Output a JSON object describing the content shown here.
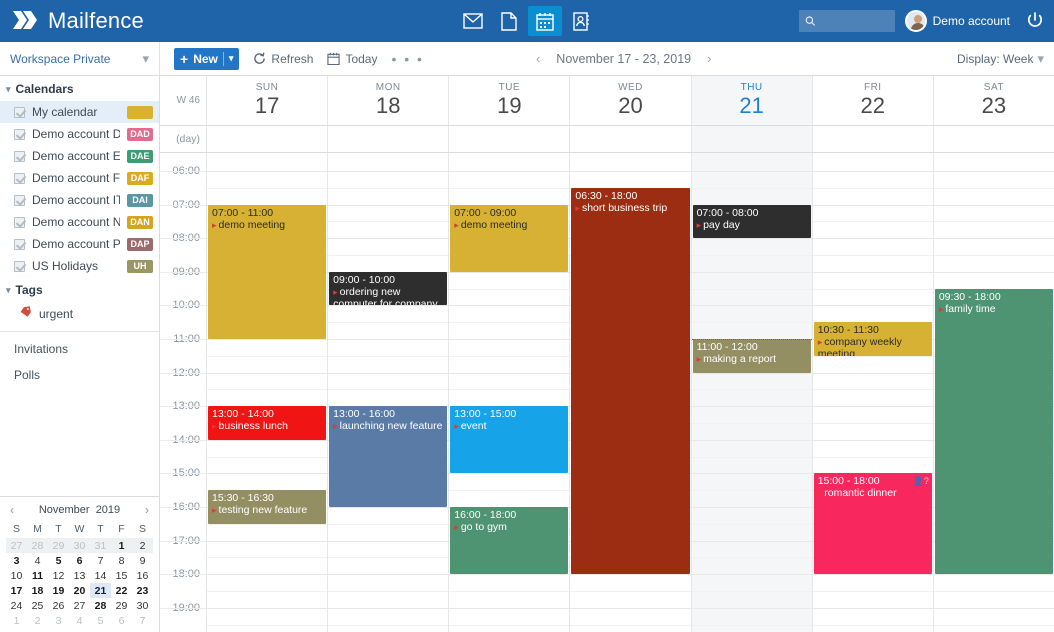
{
  "app": {
    "brand": "Mailfence",
    "nav_icons": [
      "mail-icon",
      "documents-icon",
      "calendar-icon",
      "contacts-icon"
    ],
    "active_nav": "calendar-icon",
    "search_placeholder": "",
    "search_value": "",
    "account_name": "Demo account",
    "power_icon": "power-icon"
  },
  "toolbar": {
    "workspace_label": "Workspace Private",
    "new_label": "New",
    "refresh_label": "Refresh",
    "today_label": "Today",
    "more_label": "• • •",
    "date_range": "November 17 - 23, 2019",
    "prev_label": "‹",
    "next_label": "›",
    "display_label": "Display: Week"
  },
  "sidebar": {
    "calendars_header": "Calendars",
    "calendars": [
      {
        "label": "My calendar",
        "badge": "",
        "color": "#dcb12e",
        "selected": true,
        "swatch": true
      },
      {
        "label": "Demo account DE",
        "badge": "DAD",
        "color": "#e06c8f",
        "selected": false,
        "swatch": false
      },
      {
        "label": "Demo account ES",
        "badge": "DAE",
        "color": "#3f9c74",
        "selected": false,
        "swatch": false
      },
      {
        "label": "Demo account FR",
        "badge": "DAF",
        "color": "#d9ab1e",
        "selected": false,
        "swatch": false
      },
      {
        "label": "Demo account IT",
        "badge": "DAI",
        "color": "#5a97a3",
        "selected": false,
        "swatch": false
      },
      {
        "label": "Demo account NL",
        "badge": "DAN",
        "color": "#d6a51c",
        "selected": false,
        "swatch": false
      },
      {
        "label": "Demo account PT",
        "badge": "DAP",
        "color": "#9c6a6a",
        "selected": false,
        "swatch": false
      },
      {
        "label": "US Holidays",
        "badge": "UH",
        "color": "#9a9764",
        "selected": false,
        "swatch": false
      }
    ],
    "tags_header": "Tags",
    "tags": [
      {
        "label": "urgent",
        "icon": "tag-icon",
        "color": "#d14b3c"
      }
    ],
    "links": [
      "Invitations",
      "Polls"
    ]
  },
  "minical": {
    "month": "November",
    "year": "2019",
    "prev": "‹",
    "next": "›",
    "dow": [
      "S",
      "M",
      "T",
      "W",
      "T",
      "F",
      "S"
    ],
    "weeks": [
      {
        "shade": true,
        "days": [
          {
            "n": "27",
            "out": true
          },
          {
            "n": "28",
            "out": true
          },
          {
            "n": "29",
            "out": true
          },
          {
            "n": "30",
            "out": true
          },
          {
            "n": "31",
            "out": true
          },
          {
            "n": "1",
            "bold": true
          },
          {
            "n": "2"
          }
        ]
      },
      {
        "shade": false,
        "days": [
          {
            "n": "3",
            "bold": true
          },
          {
            "n": "4"
          },
          {
            "n": "5",
            "bold": true
          },
          {
            "n": "6",
            "bold": true
          },
          {
            "n": "7"
          },
          {
            "n": "8"
          },
          {
            "n": "9"
          }
        ]
      },
      {
        "shade": false,
        "days": [
          {
            "n": "10"
          },
          {
            "n": "11",
            "bold": true
          },
          {
            "n": "12"
          },
          {
            "n": "13"
          },
          {
            "n": "14"
          },
          {
            "n": "15"
          },
          {
            "n": "16"
          }
        ]
      },
      {
        "shade": false,
        "days": [
          {
            "n": "17",
            "bold": true
          },
          {
            "n": "18",
            "bold": true
          },
          {
            "n": "19",
            "bold": true
          },
          {
            "n": "20",
            "bold": true
          },
          {
            "n": "21",
            "today": true
          },
          {
            "n": "22",
            "bold": true
          },
          {
            "n": "23",
            "bold": true
          }
        ]
      },
      {
        "shade": false,
        "days": [
          {
            "n": "24"
          },
          {
            "n": "25"
          },
          {
            "n": "26"
          },
          {
            "n": "27"
          },
          {
            "n": "28",
            "bold": true
          },
          {
            "n": "29"
          },
          {
            "n": "30"
          }
        ]
      },
      {
        "shade": false,
        "days": [
          {
            "n": "1",
            "out": true
          },
          {
            "n": "2",
            "out": true
          },
          {
            "n": "3",
            "out": true
          },
          {
            "n": "4",
            "out": true
          },
          {
            "n": "5",
            "out": true
          },
          {
            "n": "6",
            "out": true
          },
          {
            "n": "7",
            "out": true
          }
        ]
      }
    ]
  },
  "calendar": {
    "week_label": "W 46",
    "allday_label": "(day)",
    "days": [
      {
        "dow": "SUN",
        "num": "17",
        "today": false
      },
      {
        "dow": "MON",
        "num": "18",
        "today": false
      },
      {
        "dow": "TUE",
        "num": "19",
        "today": false
      },
      {
        "dow": "WED",
        "num": "20",
        "today": false
      },
      {
        "dow": "THU",
        "num": "21",
        "today": true
      },
      {
        "dow": "FRI",
        "num": "22",
        "today": false
      },
      {
        "dow": "SAT",
        "num": "23",
        "today": false
      }
    ],
    "hours": [
      "06:00",
      "07:00",
      "08:00",
      "09:00",
      "10:00",
      "11:00",
      "12:00",
      "13:00",
      "14:00",
      "15:00",
      "16:00",
      "17:00",
      "18:00",
      "19:00"
    ],
    "now_indicator": {
      "day": 4,
      "time": "11:00"
    },
    "events": [
      {
        "day": 0,
        "start": "07:00",
        "end": "11:00",
        "time": "07:00 - 11:00",
        "title": "demo meeting",
        "color": "#d6b133",
        "text": "dark"
      },
      {
        "day": 0,
        "start": "13:00",
        "end": "14:00",
        "time": "13:00 - 14:00",
        "title": "business lunch",
        "color": "#f01414",
        "text": "light"
      },
      {
        "day": 0,
        "start": "15:30",
        "end": "16:30",
        "time": "15:30 - 16:30",
        "title": "testing new feature",
        "color": "#948f62",
        "text": "light"
      },
      {
        "day": 1,
        "start": "09:00",
        "end": "10:00",
        "time": "09:00 - 10:00",
        "title": "ordering new computer for company",
        "color": "#2e2e2e",
        "text": "light"
      },
      {
        "day": 1,
        "start": "13:00",
        "end": "16:00",
        "time": "13:00 - 16:00",
        "title": "launching new feature",
        "color": "#5a7ba6",
        "text": "light"
      },
      {
        "day": 2,
        "start": "07:00",
        "end": "09:00",
        "time": "07:00 - 09:00",
        "title": "demo meeting",
        "color": "#d6b133",
        "text": "dark"
      },
      {
        "day": 2,
        "start": "13:00",
        "end": "15:00",
        "time": "13:00 - 15:00",
        "title": "event",
        "color": "#17a3e8",
        "text": "light"
      },
      {
        "day": 2,
        "start": "16:00",
        "end": "18:00",
        "time": "16:00 - 18:00",
        "title": "go to gym",
        "color": "#4e9372",
        "text": "light"
      },
      {
        "day": 3,
        "start": "06:30",
        "end": "18:00",
        "time": "06:30 - 18:00",
        "title": "short business trip",
        "color": "#9c2d12",
        "text": "light"
      },
      {
        "day": 4,
        "start": "07:00",
        "end": "08:00",
        "time": "07:00 - 08:00",
        "title": "pay day",
        "color": "#2e2e2e",
        "text": "light"
      },
      {
        "day": 4,
        "start": "11:00",
        "end": "12:00",
        "time": "11:00 - 12:00",
        "title": "making a report",
        "color": "#948f62",
        "text": "light"
      },
      {
        "day": 5,
        "start": "10:30",
        "end": "11:30",
        "time": "10:30 - 11:30",
        "title": "company weekly meeting",
        "color": "#d6b133",
        "text": "dark"
      },
      {
        "day": 5,
        "start": "15:00",
        "end": "18:00",
        "time": "15:00 - 18:00",
        "title": "romantic dinner",
        "color": "#f8285f",
        "text": "light",
        "icon": "attendee-unknown-icon"
      },
      {
        "day": 6,
        "start": "09:30",
        "end": "18:00",
        "time": "09:30 - 18:00",
        "title": "family time",
        "color": "#4e9372",
        "text": "light"
      }
    ]
  }
}
